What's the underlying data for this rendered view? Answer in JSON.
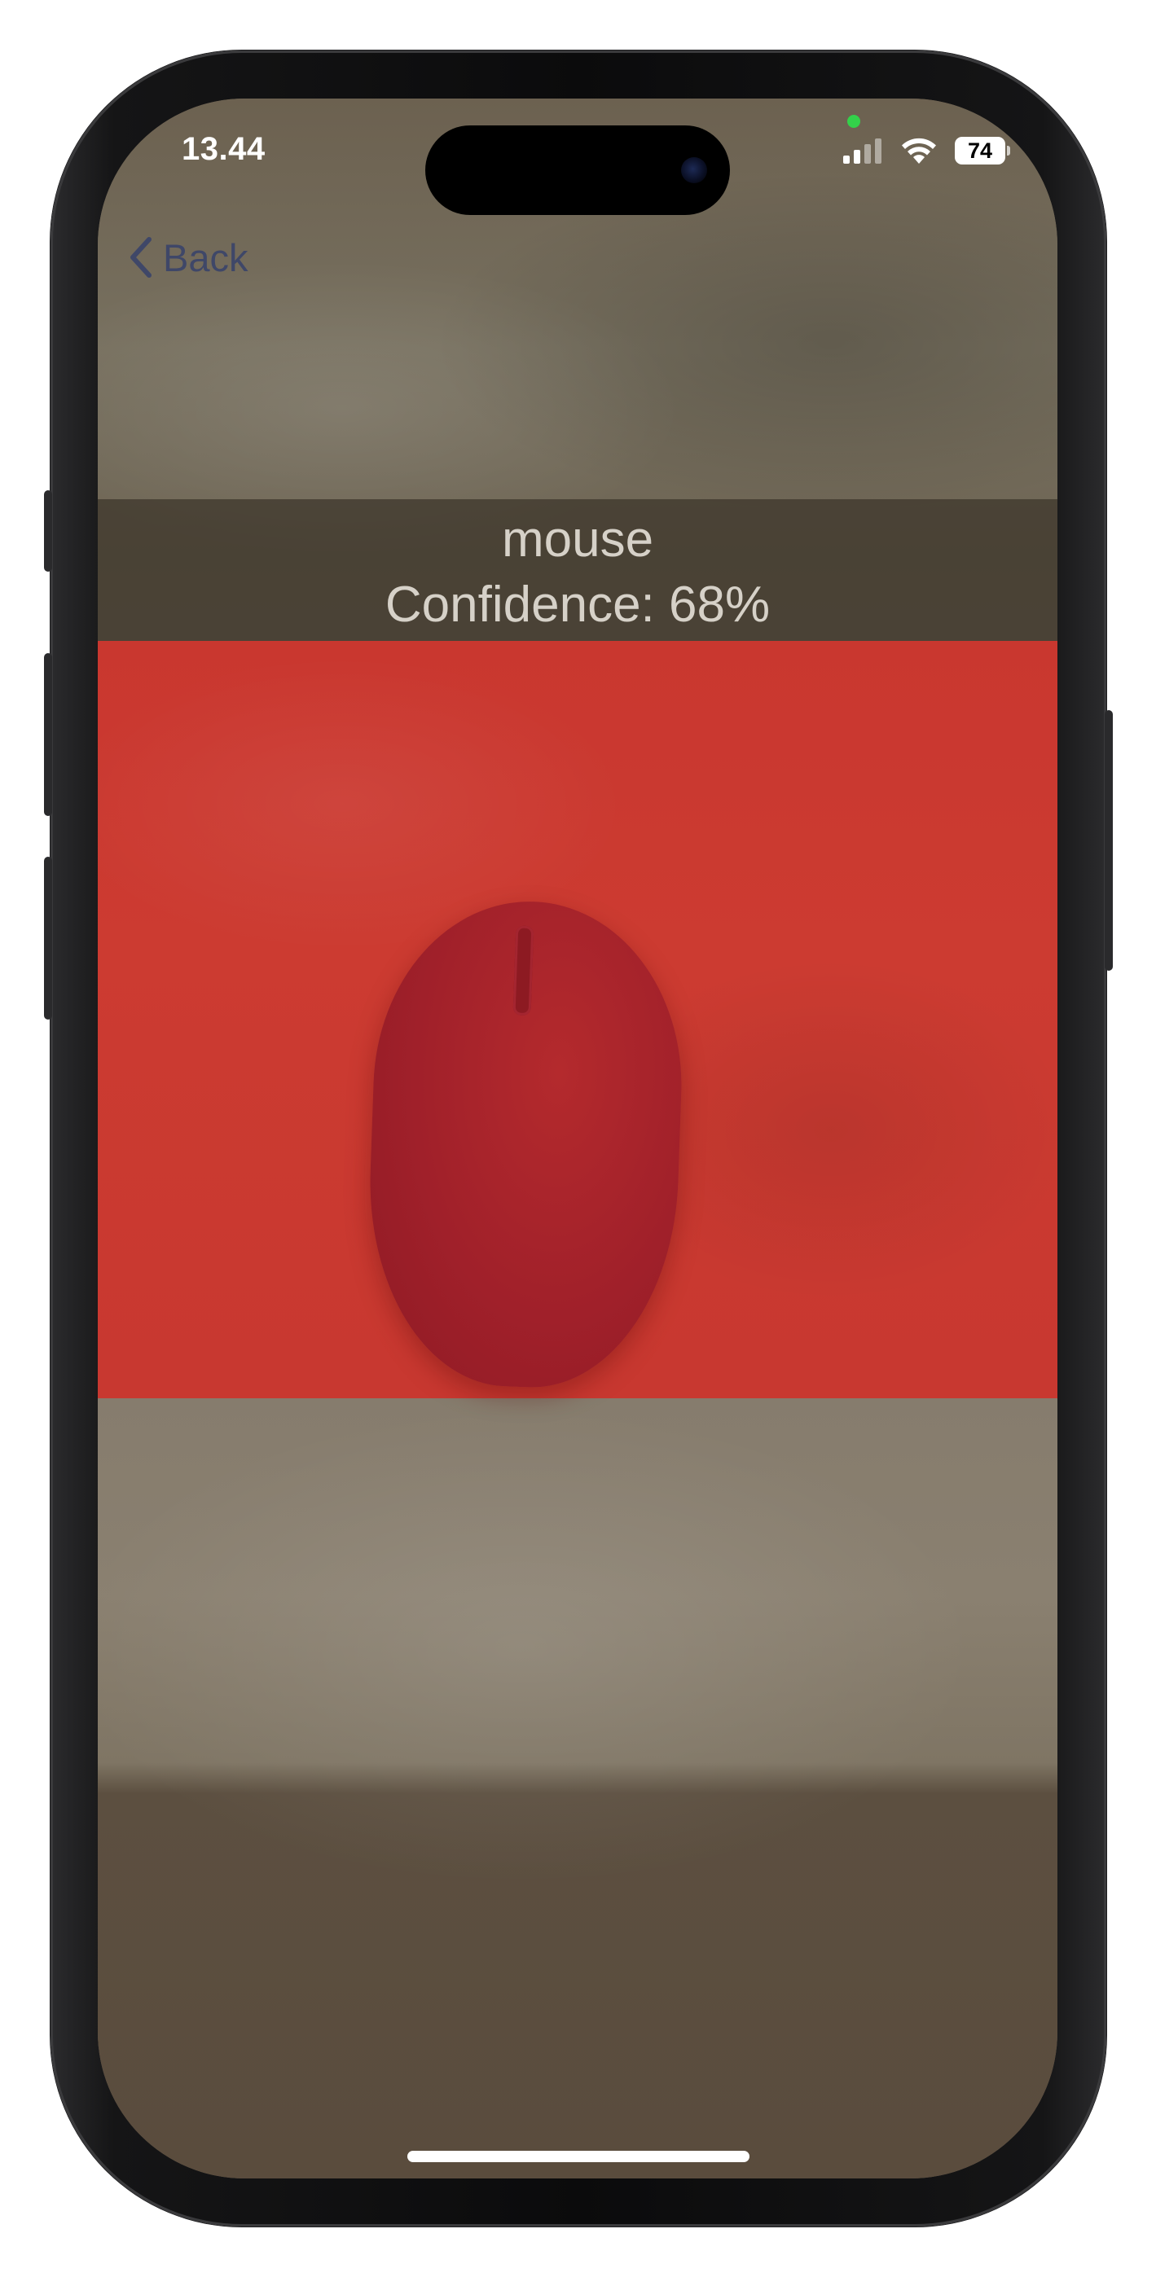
{
  "status_bar": {
    "time": "13.44",
    "battery_level": "74",
    "signal_bars_active": 2,
    "signal_bars_total": 4,
    "privacy_indicator_color": "#33d14a"
  },
  "navigation": {
    "back_label": "Back",
    "back_icon": "chevron-left-icon"
  },
  "detection": {
    "label": "mouse",
    "confidence_text": "Confidence: 68%",
    "confidence": 0.68,
    "box_color": "#cc3b31"
  }
}
